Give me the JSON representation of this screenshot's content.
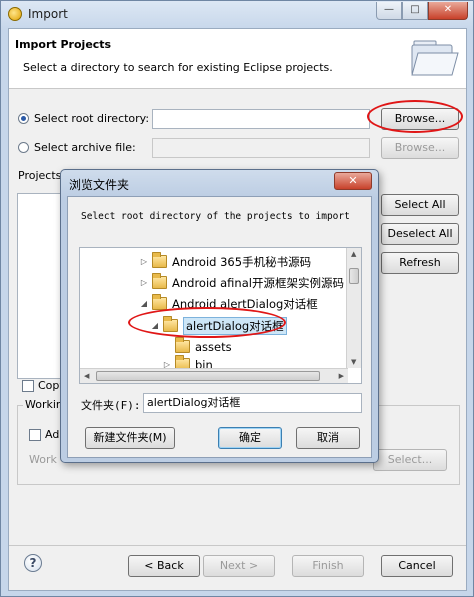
{
  "window": {
    "title": "Import"
  },
  "caption": {
    "minimize": "—",
    "maximize": "□",
    "close": "✕"
  },
  "header": {
    "title": "Import Projects",
    "description": "Select a directory to search for existing Eclipse projects."
  },
  "options": {
    "root_label": "Select root directory:",
    "archive_label": "Select archive file:",
    "browse_label": "Browse...",
    "browse2_label": "Browse..."
  },
  "projects": {
    "label": "Projects:"
  },
  "side_buttons": {
    "select_all": "Select All",
    "deselect_all": "Deselect All",
    "refresh": "Refresh"
  },
  "copy": {
    "label": "Copy"
  },
  "working": {
    "group_label": "Working",
    "add_label": "Add",
    "sets_label": "Work",
    "select_label": "Select..."
  },
  "footer": {
    "help": "?",
    "back": "< Back",
    "next": "Next >",
    "finish": "Finish",
    "cancel": "Cancel"
  },
  "dialog": {
    "title": "浏览文件夹",
    "close": "✕",
    "message": "Select root directory of the projects to import",
    "tree": [
      {
        "name": "Android 365手机秘书源码",
        "toggle": "▷"
      },
      {
        "name": "Android afinal开源框架实例源码",
        "toggle": "▷"
      },
      {
        "name": "Android alertDialog对话框",
        "toggle": "◢"
      },
      {
        "name": "alertDialog对话框",
        "toggle": "◢"
      },
      {
        "name": "assets",
        "toggle": ""
      },
      {
        "name": "bin",
        "toggle": "▷"
      }
    ],
    "folder_label": "文件夹(F):",
    "folder_value": "alertDialog对话框",
    "new_folder": "新建文件夹(M)",
    "ok": "确定",
    "cancel": "取消"
  }
}
